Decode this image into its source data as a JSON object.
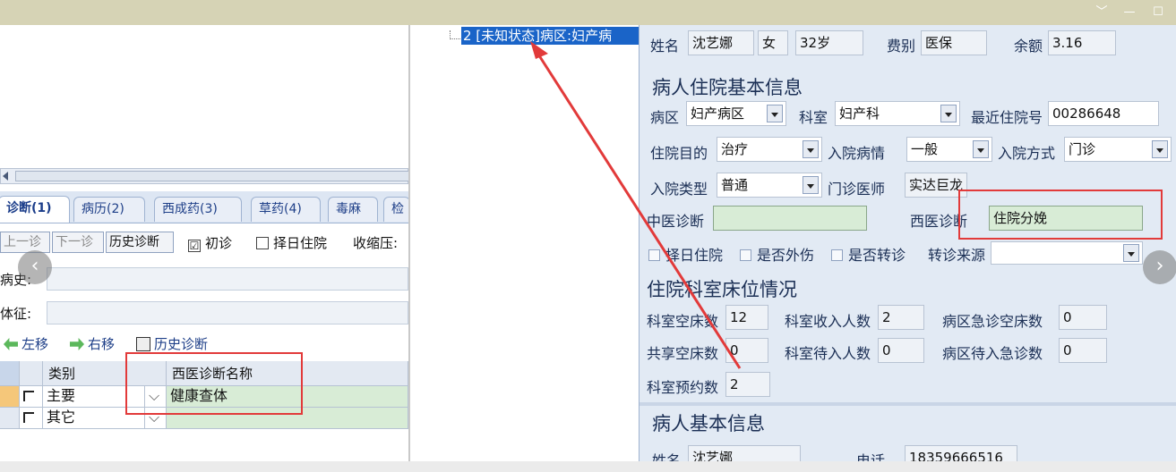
{
  "window": {
    "controls": [
      "﹀",
      "—",
      "☐"
    ]
  },
  "left": {
    "tabs": [
      {
        "label": "诊断(1)",
        "active": true
      },
      {
        "label": "病历(2)"
      },
      {
        "label": "西成药(3)"
      },
      {
        "label": "草药(4)"
      },
      {
        "label": "毒麻"
      },
      {
        "label": "检"
      }
    ],
    "nav": {
      "prev": "上一诊",
      "next": "下一诊",
      "history": "历史诊断"
    },
    "checks": {
      "first": "初诊",
      "first_mark": "☑",
      "select_day": "择日住院",
      "systolic": "收缩压:"
    },
    "history_label": "病史:",
    "sign_label": "体征:",
    "actions": {
      "left": "左移",
      "right": "右移",
      "history": "历史诊断"
    },
    "grid": {
      "headers": [
        "类别",
        "西医诊断名称"
      ],
      "rows": [
        {
          "type": "主要",
          "name": "健康查体"
        },
        {
          "type": "其它",
          "name": ""
        }
      ]
    }
  },
  "tree": {
    "node": "2 [未知状态]病区:妇产病"
  },
  "right": {
    "patient": {
      "name_label": "姓名",
      "name": "沈艺娜",
      "gender": "女",
      "age": "32岁",
      "fee_label": "费别",
      "fee": "医保",
      "balance_label": "余额",
      "balance": "3.16"
    },
    "admission": {
      "title": "病人住院基本信息",
      "ward_label": "病区",
      "ward": "妇产病区",
      "dept_label": "科室",
      "dept": "妇产科",
      "recent_label": "最近住院号",
      "recent": "00286648",
      "purpose_label": "住院目的",
      "purpose": "治疗",
      "condition_label": "入院病情",
      "condition": "一般",
      "method_label": "入院方式",
      "method": "门诊",
      "type_label": "入院类型",
      "type": "普通",
      "doctor_label": "门诊医师",
      "doctor": "实达巨龙",
      "tcm_label": "中医诊断",
      "tcm": "",
      "wm_label": "西医诊断",
      "wm": "住院分娩",
      "opt_selectday": "择日住院",
      "opt_injury": "是否外伤",
      "opt_transfer": "是否转诊",
      "source_label": "转诊来源",
      "source": ""
    },
    "beds": {
      "title": "住院科室床位情况",
      "empty_label": "科室空床数",
      "empty": "12",
      "recv_label": "科室收入人数",
      "recv": "2",
      "emerg_label": "病区急诊空床数",
      "emerg": "0",
      "shared_label": "共享空床数",
      "shared": "0",
      "waiting_label": "科室待入人数",
      "waiting": "0",
      "wait_emerg_label": "病区待入急诊数",
      "wait_emerg": "0",
      "reserve_label": "科室预约数",
      "reserve": "2"
    },
    "basic": {
      "title": "病人基本信息",
      "name_label": "姓名",
      "name": "沈艺娜",
      "phone_label": "电话",
      "phone": "18359666516"
    }
  },
  "colors": {
    "accent": "#1a64c8",
    "annotation": "#e23a3a",
    "green_field": "#d8ecd6"
  }
}
